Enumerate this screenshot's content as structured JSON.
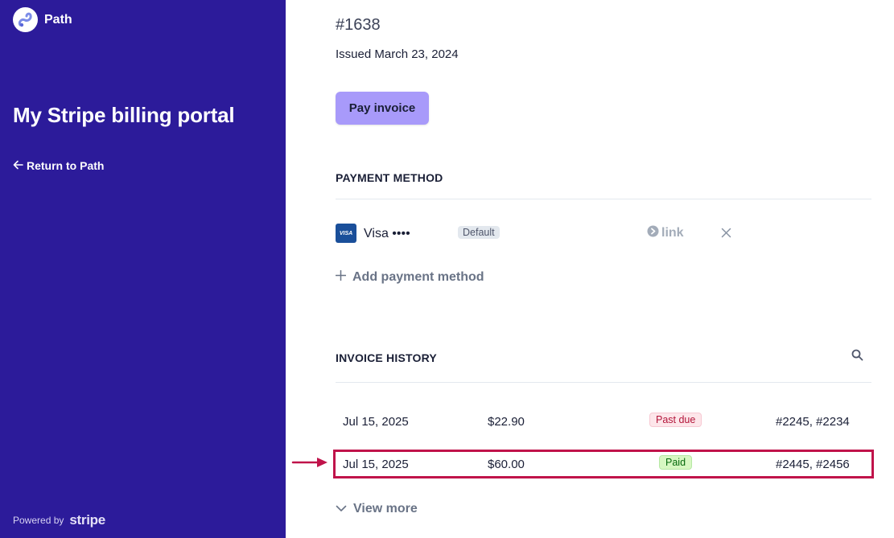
{
  "sidebar": {
    "brand_name": "Path",
    "portal_title": "My Stripe billing portal",
    "return_link": "Return to Path",
    "powered_by": "Powered by",
    "stripe_word": "stripe"
  },
  "invoice": {
    "number": "#1638",
    "issued": "Issued March 23, 2024",
    "pay_button": "Pay invoice"
  },
  "payment_method": {
    "heading": "PAYMENT METHOD",
    "card_brand_badge": "VISA",
    "card_label": "Visa ••••",
    "default_badge": "Default",
    "link_label": "link",
    "add_label": "Add payment method"
  },
  "invoice_history": {
    "heading": "INVOICE HISTORY",
    "rows": [
      {
        "date": "Jul 15, 2025",
        "amount": "$22.90",
        "status": "Past due",
        "numbers": "#2245, #2234"
      },
      {
        "date": "Jul 15, 2025",
        "amount": "$60.00",
        "status": "Paid",
        "numbers": "#2445, #2456"
      }
    ],
    "view_more": "View more"
  },
  "colors": {
    "sidebar_bg": "#2c1b9a",
    "accent_button": "#a89afa",
    "highlight": "#c0134a",
    "past_due": "#b3153a",
    "paid": "#05690d"
  },
  "icons": [
    "path-logo-icon",
    "arrow-left-icon",
    "visa-card-icon",
    "link-icon",
    "close-icon",
    "plus-icon",
    "search-icon",
    "chevron-down-icon",
    "pointer-arrow-icon"
  ]
}
